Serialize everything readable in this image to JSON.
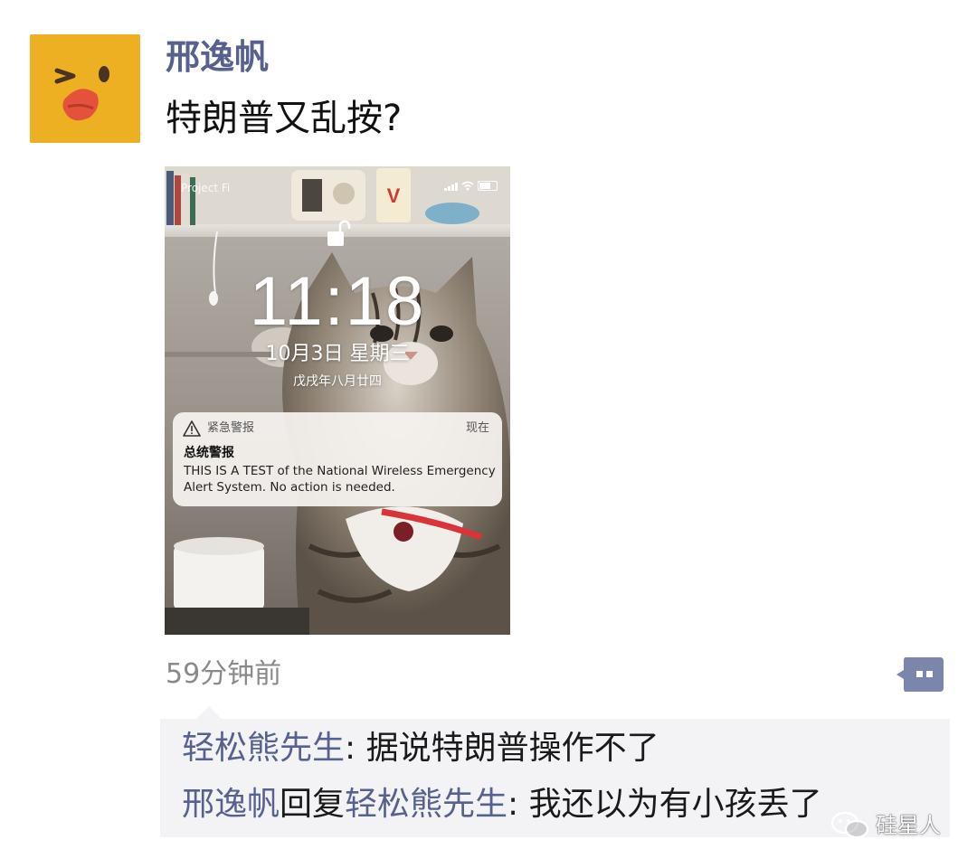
{
  "post": {
    "author": "邢逸帆",
    "text": "特朗普又乱按?",
    "timestamp": "59分钟前"
  },
  "lockscreen": {
    "carrier": "Project Fi",
    "time": "11:18",
    "date": "10月3日 星期三",
    "lunar": "戊戌年八月廿四",
    "notification": {
      "app": "紧急警报",
      "time": "现在",
      "title": "总统警报",
      "body": "THIS IS A TEST of the National Wireless Emergency Alert System. No action is needed."
    }
  },
  "comments": [
    {
      "author": "轻松熊先生",
      "sep": ": ",
      "text": "据说特朗普操作不了"
    },
    {
      "author": "邢逸帆",
      "reply_word": "回复",
      "reply_to": "轻松熊先生",
      "sep": ": ",
      "text": "我还以为有小孩丢了"
    }
  ],
  "watermark": "硅星人",
  "colors": {
    "name": "#56618e",
    "avatar_bg": "#ecb022",
    "comment_bg": "#f3f3f5"
  }
}
